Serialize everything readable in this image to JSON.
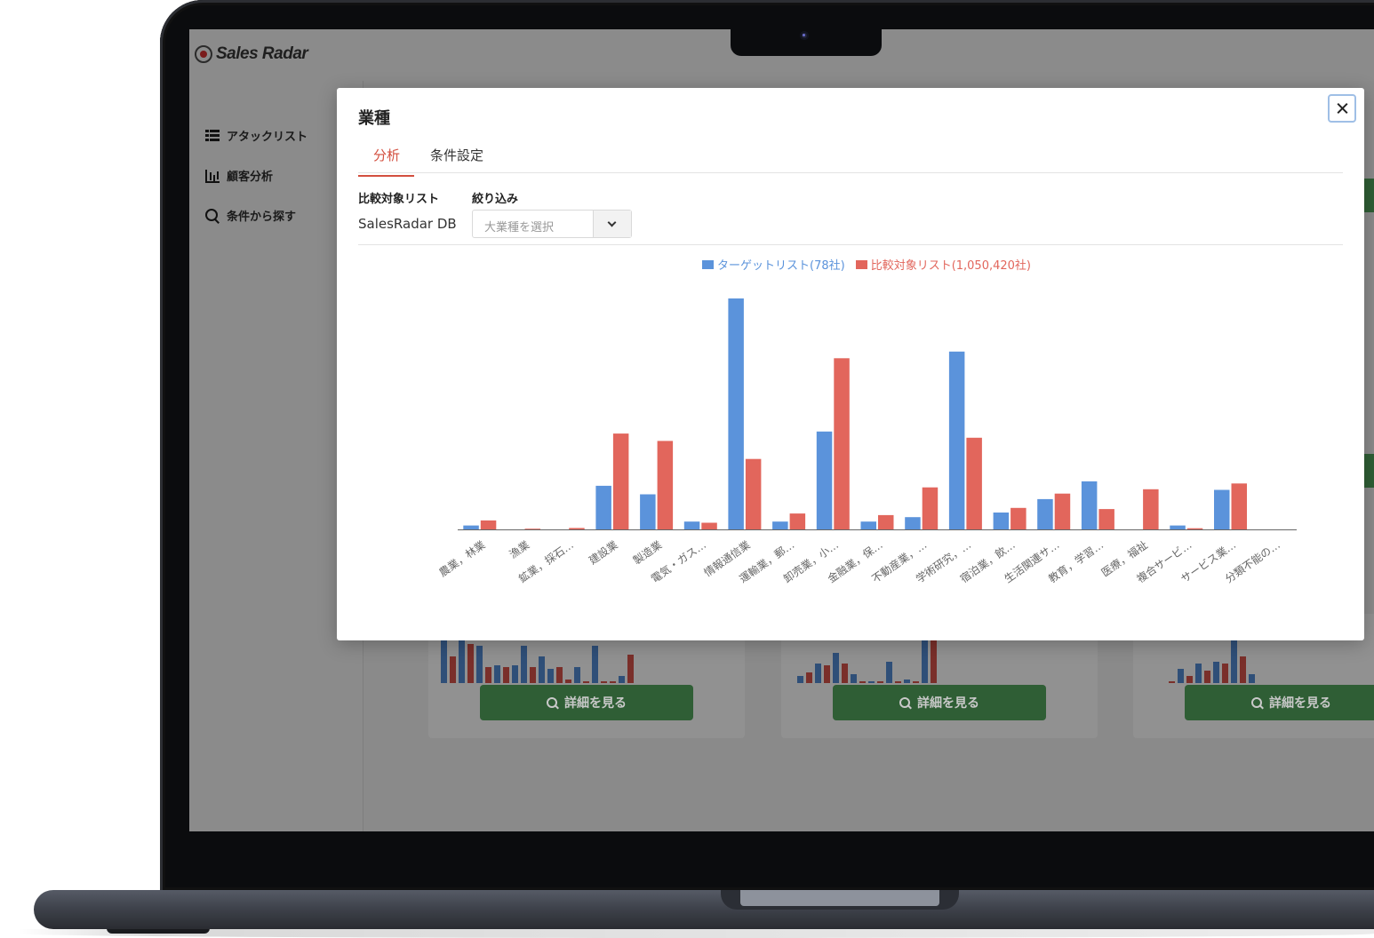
{
  "app": {
    "logo_text": "Sales Radar",
    "sidebar": [
      {
        "label": "アタックリスト",
        "icon": "list-icon"
      },
      {
        "label": "顧客分析",
        "icon": "bar-chart-icon"
      },
      {
        "label": "条件から探す",
        "icon": "search-icon"
      }
    ],
    "cards": [
      {
        "button_label": "詳細を見る"
      },
      {
        "button_label": "詳細を見る"
      },
      {
        "button_label": "詳細を見る"
      }
    ]
  },
  "modal": {
    "title": "業種",
    "tabs": [
      {
        "label": "分析",
        "active": true
      },
      {
        "label": "条件設定",
        "active": false
      }
    ],
    "compare_label": "比較対象リスト",
    "compare_value": "SalesRadar DB",
    "filter_label": "絞り込み",
    "filter_placeholder": "大業種を選択"
  },
  "colors": {
    "target": "#5b93db",
    "compare": "#e2665c",
    "accent": "#d34f3f",
    "button_green": "#2f5e35"
  },
  "chart_data": {
    "type": "bar",
    "legend_position": "top-center",
    "grid": false,
    "categories": [
      "農業，林業",
      "漁業",
      "鉱業，採石…",
      "建設業",
      "製造業",
      "電気・ガス…",
      "情報通信業",
      "運輸業，郵…",
      "卸売業，小…",
      "金融業，保…",
      "不動産業，…",
      "学術研究，…",
      "宿泊業，飲…",
      "生活関連サ…",
      "教育，学習…",
      "医療，福祉",
      "複合サービ…",
      "サービス業…",
      "分類不能の…"
    ],
    "series": [
      {
        "name": "ターゲットリスト(78社)",
        "values": [
          1.7,
          0,
          0,
          18.9,
          15.2,
          3.4,
          100,
          3.4,
          42.4,
          3.4,
          5.3,
          77.0,
          7.3,
          13.1,
          20.8,
          0,
          1.7,
          17.1,
          0
        ]
      },
      {
        "name": "比較対象リスト(1,050,420社)",
        "values": [
          3.9,
          0.3,
          0.6,
          41.5,
          38.3,
          2.9,
          30.5,
          6.9,
          74.1,
          6.2,
          18.2,
          39.7,
          9.3,
          15.5,
          8.8,
          17.4,
          0.5,
          19.9,
          0
        ]
      }
    ]
  }
}
